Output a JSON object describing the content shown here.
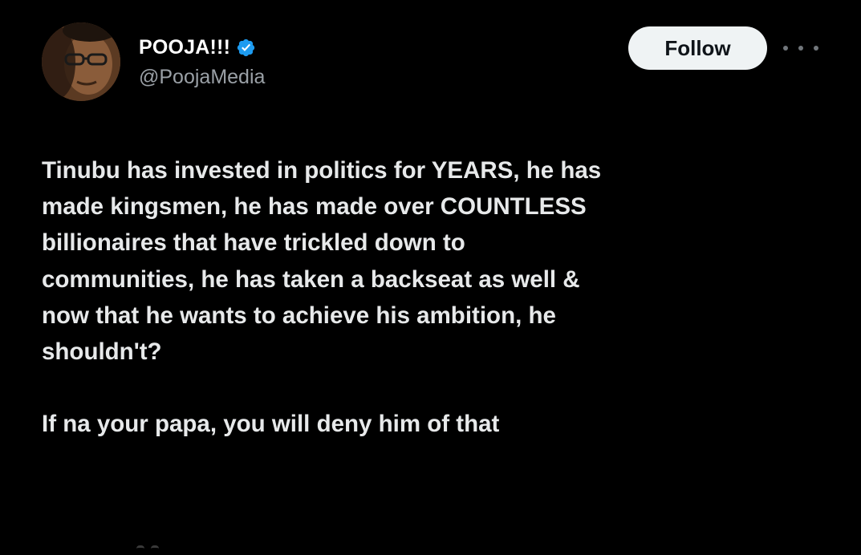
{
  "author": {
    "display_name": "POOJA!!!",
    "handle": "@PoojaMedia",
    "verified": true,
    "avatar": "profile-photo"
  },
  "actions": {
    "follow_label": "Follow",
    "more_icon": "ellipsis-icon"
  },
  "post": {
    "paragraph_1": "Tinubu has invested in politics for YEARS, he has\nmade kingsmen, he has made over COUNTLESS\nbillionaires that have trickled down to\ncommunities, he has taken a backseat as well &\nnow that he wants to achieve his ambition, he\nshouldn't?",
    "paragraph_2": "If na your papa, you will deny him of that"
  },
  "colors": {
    "background": "#000000",
    "text": "#e7e9ea",
    "handle": "#9aa0a6",
    "verified": "#1d9bf0",
    "follow_bg": "#eff3f4",
    "follow_text": "#0f1419"
  }
}
